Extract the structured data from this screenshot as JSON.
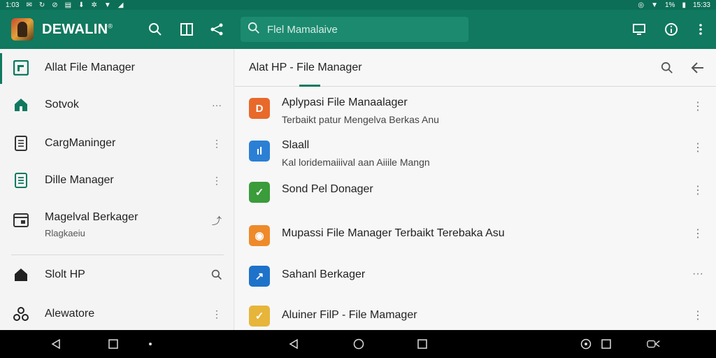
{
  "status_bar": {
    "time_left": "1:03",
    "battery": "1%",
    "time_right": "15:33"
  },
  "app_bar": {
    "brand": "DEWALIN",
    "brand_mark": "®",
    "search_placeholder": "Flel Mamalaive",
    "icons": [
      "search-icon",
      "columns-icon",
      "share-icon",
      "window-icon",
      "info-icon",
      "more-vert-icon"
    ]
  },
  "sidebar": {
    "items": [
      {
        "label": "Allat File Manager",
        "icon": "file-manager-icon",
        "active": true
      },
      {
        "label": "Sotvok",
        "icon": "home-icon",
        "trail": "···"
      },
      {
        "label": "CargManinger",
        "icon": "document-icon",
        "trail": "⋮"
      },
      {
        "label": "Dille Manager",
        "icon": "list-document-icon",
        "trail": "⋮"
      },
      {
        "label": "Magelval Berkager",
        "sub": "Rlagkaeiu",
        "icon": "calendar-icon",
        "trail": "⤴"
      },
      {
        "label": "Slolt HP",
        "icon": "house-icon",
        "trail": "🔍"
      },
      {
        "label": "Alewatore",
        "icon": "share-nodes-icon",
        "trail": "⋮"
      }
    ]
  },
  "main": {
    "title": "Alat HP - File Manager",
    "rows": [
      {
        "title": "Aplypasi File Manaalager",
        "sub": "Terbaikt patur Mengelva Berkas Anu",
        "color": "#e8692a",
        "glyph": "D"
      },
      {
        "title": "Slaall",
        "sub": "Kal loridemaiiival aan Aiiile Mangn",
        "color": "#2b7fd4",
        "glyph": "ıl"
      },
      {
        "title": "Sond Pel Donager",
        "sub": "",
        "color": "#3a9c3a",
        "glyph": "✓"
      },
      {
        "title": "Mupassi File Manager Terbaikt Terebaka Asu",
        "sub": "",
        "color": "#ee8a2a",
        "glyph": "◉"
      },
      {
        "title": "Sahanl Berkager",
        "sub": "",
        "color": "#1e72c9",
        "glyph": "↗"
      },
      {
        "title": "Aluiner FilP - File Mamager",
        "sub": "",
        "color": "#e7b53a",
        "glyph": "✓"
      }
    ]
  },
  "colors": {
    "primary": "#10795f",
    "status_bar": "#0c6e56"
  }
}
